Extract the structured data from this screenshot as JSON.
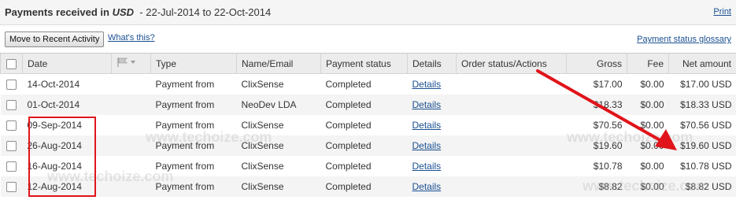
{
  "header": {
    "title_prefix": "Payments received",
    "title_in": "in",
    "currency": "USD",
    "range": "- 22-Jul-2014 to 22-Oct-2014",
    "print_label": "Print"
  },
  "toolbar": {
    "move_label": "Move to Recent Activity",
    "whats_this_label": "What's this?",
    "glossary_label": "Payment status glossary"
  },
  "table": {
    "columns": [
      "Date",
      "",
      "Type",
      "Name/Email",
      "Payment status",
      "Details",
      "Order status/Actions",
      "Gross",
      "Fee",
      "Net amount"
    ],
    "rows": [
      {
        "date": "14-Oct-2014",
        "type": "Payment from",
        "name": "ClixSense",
        "status": "Completed",
        "details": "Details",
        "order": "",
        "gross": "$17.00",
        "fee": "$0.00",
        "net": "$17.00 USD"
      },
      {
        "date": "01-Oct-2014",
        "type": "Payment from",
        "name": "NeoDev LDA",
        "status": "Completed",
        "details": "Details",
        "order": "",
        "gross": "$18.33",
        "fee": "$0.00",
        "net": "$18.33 USD"
      },
      {
        "date": "09-Sep-2014",
        "type": "Payment from",
        "name": "ClixSense",
        "status": "Completed",
        "details": "Details",
        "order": "",
        "gross": "$70.56",
        "fee": "$0.00",
        "net": "$70.56 USD"
      },
      {
        "date": "26-Aug-2014",
        "type": "Payment from",
        "name": "ClixSense",
        "status": "Completed",
        "details": "Details",
        "order": "",
        "gross": "$19.60",
        "fee": "$0.00",
        "net": "$19.60 USD"
      },
      {
        "date": "16-Aug-2014",
        "type": "Payment from",
        "name": "ClixSense",
        "status": "Completed",
        "details": "Details",
        "order": "",
        "gross": "$10.78",
        "fee": "$0.00",
        "net": "$10.78 USD"
      },
      {
        "date": "12-Aug-2014",
        "type": "Payment from",
        "name": "ClixSense",
        "status": "Completed",
        "details": "Details",
        "order": "",
        "gross": "$8.82",
        "fee": "$0.00",
        "net": "$8.82 USD"
      }
    ]
  },
  "watermark": "www.techoize.com",
  "colors": {
    "link": "#1a4f91",
    "annotation": "#e0141a",
    "header_bg": "#f5f5f5"
  }
}
